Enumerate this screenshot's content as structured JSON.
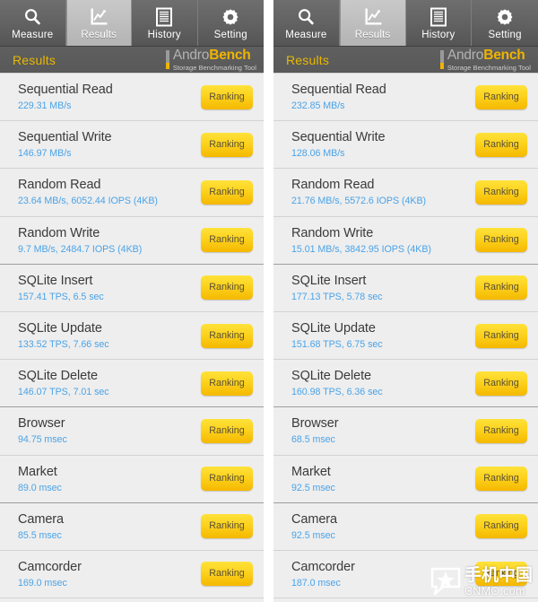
{
  "app": {
    "brand_primary": "Andro",
    "brand_secondary": "Bench",
    "brand_tagline": "Storage Benchmarking Tool",
    "accent_color": "#f0b400",
    "value_color": "#4aa3e8",
    "title": "Results"
  },
  "tabs": [
    {
      "label": "Measure",
      "icon": "magnifier-icon",
      "selected": false
    },
    {
      "label": "Results",
      "icon": "chart-icon",
      "selected": true
    },
    {
      "label": "History",
      "icon": "document-icon",
      "selected": false
    },
    {
      "label": "Setting",
      "icon": "gear-icon",
      "selected": false
    }
  ],
  "button_label": "Ranking",
  "panels": [
    {
      "id": "left",
      "title": "Results",
      "rows": [
        {
          "name": "Sequential Read",
          "value": "229.31 MB/s"
        },
        {
          "name": "Sequential Write",
          "value": "146.97 MB/s"
        },
        {
          "name": "Random Read",
          "value": "23.64 MB/s, 6052.44 IOPS (4KB)"
        },
        {
          "name": "Random Write",
          "value": "9.7 MB/s, 2484.7 IOPS (4KB)"
        },
        {
          "name": "SQLite Insert",
          "value": "157.41 TPS, 6.5 sec"
        },
        {
          "name": "SQLite Update",
          "value": "133.52 TPS, 7.66 sec"
        },
        {
          "name": "SQLite Delete",
          "value": "146.07 TPS, 7.01 sec"
        },
        {
          "name": "Browser",
          "value": "94.75 msec"
        },
        {
          "name": "Market",
          "value": "89.0 msec"
        },
        {
          "name": "Camera",
          "value": "85.5 msec"
        },
        {
          "name": "Camcorder",
          "value": "169.0 msec"
        }
      ]
    },
    {
      "id": "right",
      "title": "Results",
      "rows": [
        {
          "name": "Sequential Read",
          "value": "232.85 MB/s"
        },
        {
          "name": "Sequential Write",
          "value": "128.06 MB/s"
        },
        {
          "name": "Random Read",
          "value": "21.76 MB/s, 5572.6 IOPS (4KB)"
        },
        {
          "name": "Random Write",
          "value": "15.01 MB/s, 3842.95 IOPS (4KB)"
        },
        {
          "name": "SQLite Insert",
          "value": "177.13 TPS, 5.78 sec"
        },
        {
          "name": "SQLite Update",
          "value": "151.68 TPS, 6.75 sec"
        },
        {
          "name": "SQLite Delete",
          "value": "160.98 TPS, 6.36 sec"
        },
        {
          "name": "Browser",
          "value": "68.5 msec"
        },
        {
          "name": "Market",
          "value": "92.5 msec"
        },
        {
          "name": "Camera",
          "value": "92.5 msec"
        },
        {
          "name": "Camcorder",
          "value": "187.0 msec"
        }
      ]
    }
  ],
  "watermark": {
    "chinese": "手机中国",
    "latin": "CNMO.com",
    "logo": "star-bubble-icon"
  }
}
